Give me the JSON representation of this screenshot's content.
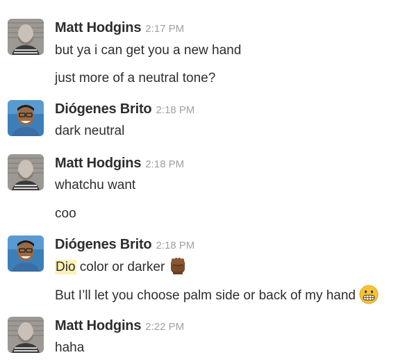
{
  "messages": [
    {
      "author": "Matt Hodgins",
      "time": "2:17 PM",
      "avatar": "matt-avatar",
      "lines": [
        "but ya i can get you a new hand",
        "just more of a neutral tone?"
      ]
    },
    {
      "author": "Diógenes Brito",
      "time": "2:18 PM",
      "avatar": "diogenes-avatar",
      "lines": [
        "dark neutral"
      ]
    },
    {
      "author": "Matt Hodgins",
      "time": "2:18 PM",
      "avatar": "matt-avatar",
      "lines": [
        "whatchu want",
        "coo"
      ]
    },
    {
      "author": "Diógenes Brito",
      "time": "2:18 PM",
      "avatar": "diogenes-avatar",
      "lines": [
        {
          "highlight": "Dio",
          "rest": " color or darker",
          "emoji": "raised-fist-dark-skin-emoji"
        },
        {
          "text": "But I’ll let you choose palm side or back of my hand",
          "emoji": "grimacing-face-emoji"
        }
      ]
    },
    {
      "author": "Matt Hodgins",
      "time": "2:22 PM",
      "avatar": "matt-avatar",
      "lines": [
        "haha"
      ]
    }
  ],
  "colors": {
    "text": "#2c2d30",
    "timestamp": "#a0a0a2",
    "mention_highlight": "#fdf2b3"
  }
}
